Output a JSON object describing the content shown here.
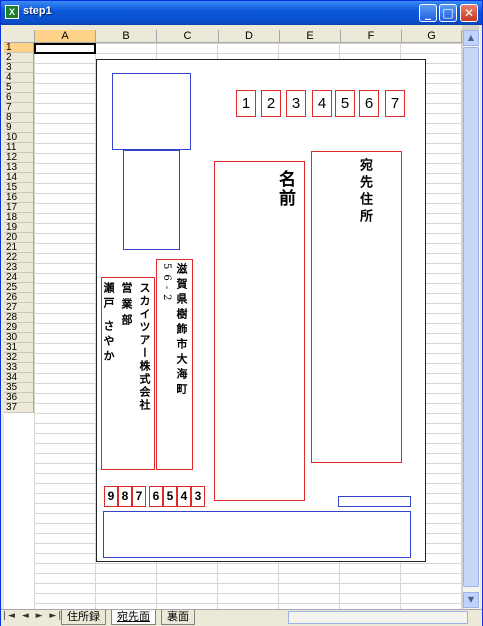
{
  "window": {
    "title": "step1"
  },
  "columns": [
    "A",
    "B",
    "C",
    "D",
    "E",
    "F",
    "G"
  ],
  "rows": [
    "1",
    "2",
    "3",
    "4",
    "5",
    "6",
    "7",
    "8",
    "9",
    "10",
    "11",
    "12",
    "13",
    "14",
    "15",
    "16",
    "17",
    "18",
    "19",
    "20",
    "21",
    "22",
    "23",
    "24",
    "25",
    "26",
    "27",
    "28",
    "29",
    "30",
    "31",
    "32",
    "33",
    "34",
    "35",
    "36",
    "37"
  ],
  "postcard": {
    "postal_code_digits": [
      "1",
      "2",
      "3",
      "4",
      "5",
      "6",
      "7"
    ],
    "recipient_name_label": "名前",
    "recipient_address_label": "宛先住所",
    "sender_address": "滋賀県樹飾市大海町",
    "sender_postcode_vertical": "56-2",
    "sender_company": "スカイツアー株式会社",
    "sender_department": "営業部",
    "sender_name": "瀬戸 さやか",
    "sender_postal_digits_left": [
      "9",
      "8",
      "7"
    ],
    "sender_postal_digits_right": [
      "6",
      "5",
      "4",
      "3"
    ]
  },
  "sheet_tabs": [
    "住所録",
    "宛先面",
    "裏面"
  ],
  "active_tab": "宛先面",
  "nav_buttons": "|◄ ◄ ► ►|"
}
